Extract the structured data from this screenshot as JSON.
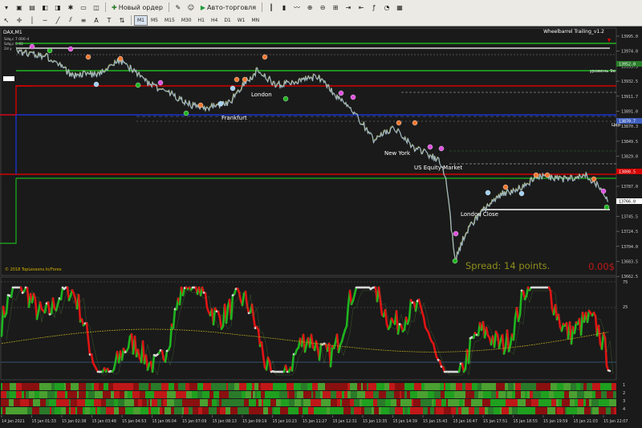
{
  "toolbar": {
    "new_order_label": "Новый ордер",
    "autotrading_label": "Авто-торговля",
    "timeframes": [
      "M1",
      "M5",
      "M15",
      "M30",
      "H1",
      "H4",
      "D1",
      "W1",
      "MN"
    ],
    "active_timeframe": "M1"
  },
  "chart": {
    "symbol_label": "DAX,M1",
    "indicator_title": "Wheelbarrel Trailing_v1.2",
    "copyright": "© 2018 TopLessons.In/Forex",
    "spread_text": "Spread: 14 points.",
    "pnl_text": "0.00$",
    "level_label": "уровень 9е",
    "price_label_short": "Цен",
    "sessions": [
      "London",
      "Frankfurt",
      "New York",
      "US Equity Market",
      "London Close"
    ],
    "left_mini_labels": [
      "Sdq,c 7.000 d",
      "Sdq,c 0.92",
      "2d y"
    ],
    "price_ticks": [
      "13995.0",
      "13974.0",
      "13953.3",
      "13932.5",
      "13911.7",
      "13891.0",
      "13870.3",
      "13849.5",
      "13829.0",
      "13808.3",
      "13787.0",
      "13766.0",
      "13745.5",
      "13724.5",
      "13704.0",
      "13683.5",
      "13662.5"
    ],
    "highlight_prices": [
      {
        "price": "13952.0",
        "color": "#2a7d2a"
      },
      {
        "price": "13870.7",
        "color": "#3f5fbf"
      },
      {
        "price": "13808.5",
        "color": "#d40000"
      },
      {
        "price": "13766.0",
        "color": "#ffffff"
      }
    ],
    "oscillator_ticks": [
      "75",
      "25"
    ],
    "heat_rows_labels": [
      "1",
      "2",
      "3",
      "4"
    ],
    "time_labels": [
      "14 Jan 2021",
      "15 Jan 01:33",
      "15 Jan 02:38",
      "15 Jan 03:48",
      "15 Jan 04:53",
      "15 Jan 06:04",
      "15 Jan 07:09",
      "15 Jan 08:13",
      "15 Jan 09:19",
      "15 Jan 10:23",
      "15 Jan 11:27",
      "15 Jan 12:31",
      "15 Jan 13:35",
      "15 Jan 14:39",
      "15 Jan 15:43",
      "15 Jan 16:47",
      "15 Jan 17:51",
      "15 Jan 18:55",
      "15 Jan 19:59",
      "15 Jan 21:03",
      "15 Jan 22:07"
    ],
    "colors": {
      "bull": "#1fb51f",
      "bear": "#e01414",
      "neutral": "#d8d8d8",
      "gold": "#b0a020",
      "blue": "#1a33cc",
      "price": "#9fb8c8"
    }
  }
}
